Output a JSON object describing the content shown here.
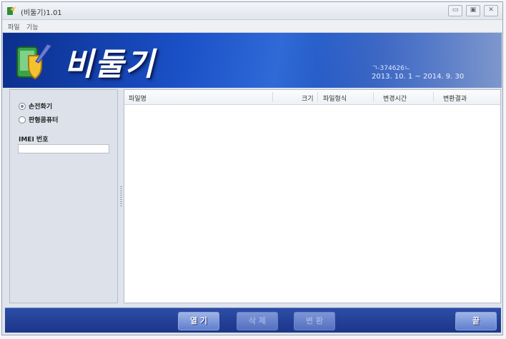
{
  "window": {
    "title": "(비둘기)1.01",
    "controls": [
      "▭",
      "▣",
      "✕"
    ]
  },
  "menu": {
    "items": [
      "파일",
      "기능"
    ]
  },
  "banner": {
    "title": "비둘기",
    "code": "ㄱ-374626ㄴ",
    "dates": "2013. 10. 1 ~ 2014. 9. 30"
  },
  "left_panel": {
    "radios": [
      {
        "label": "손전화기",
        "checked": true
      },
      {
        "label": "판형콤퓨터",
        "checked": false
      }
    ],
    "imei_label": "IMEI 번호",
    "imei_value": ""
  },
  "file_table": {
    "columns": [
      "파일명",
      "크기",
      "파일형식",
      "변경시간",
      "변환결과"
    ],
    "rows": []
  },
  "buttons": {
    "open": "열 기",
    "delete": "삭 제",
    "convert": "변 환",
    "exit": "끝"
  },
  "colors": {
    "banner": "#1a4fc6",
    "bottom_bar": "#1b3589",
    "accent_shield": "#f2c230"
  }
}
